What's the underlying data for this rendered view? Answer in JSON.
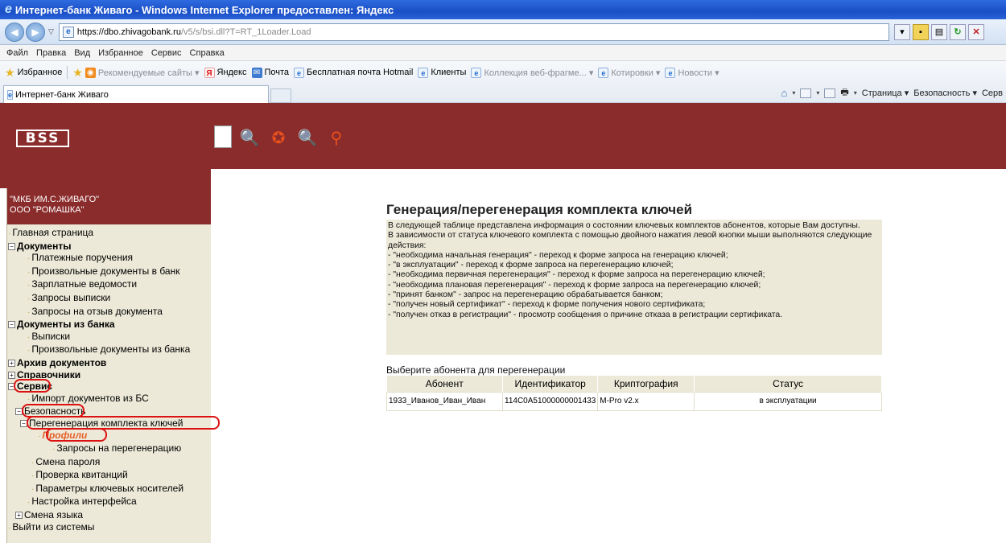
{
  "browser": {
    "title": "Интернет-банк Живаго - Windows Internet Explorer предоставлен: Яндекс",
    "url_host": "https://dbo.zhivagobank.ru",
    "url_path": "/v5/s/bsi.dll?T=RT_1Loader.Load",
    "menu": [
      "Файл",
      "Правка",
      "Вид",
      "Избранное",
      "Сервис",
      "Справка"
    ],
    "favorites_label": "Избранное",
    "favorites": [
      {
        "label": "Рекомендуемые сайты ▾",
        "icon": "rss-icon",
        "muted": true
      },
      {
        "label": "Яндекс",
        "icon": "yandex-icon",
        "muted": false
      },
      {
        "label": "Почта",
        "icon": "mail-icon",
        "muted": false
      },
      {
        "label": "Бесплатная почта Hotmail",
        "icon": "ie-page-icon",
        "muted": false
      },
      {
        "label": "Клиенты",
        "icon": "ie-page-icon",
        "muted": false
      },
      {
        "label": "Коллекция веб-фрагме... ▾",
        "icon": "ie-page-icon",
        "muted": true
      },
      {
        "label": "Котировки ▾",
        "icon": "ie-page-icon",
        "muted": true
      },
      {
        "label": "Новости ▾",
        "icon": "ie-page-icon",
        "muted": true
      }
    ],
    "tab_title": "Интернет-банк Живаго",
    "command_bar": {
      "page": "Страница",
      "security": "Безопасность",
      "service": "Серв"
    }
  },
  "app": {
    "logo": "BSS",
    "org_name": "\"МКБ ИМ.С.ЖИВАГО\"",
    "org_client": "ООО \"РОМАШКА\"",
    "nav": {
      "home": "Главная страница",
      "documents": "Документы",
      "payment_orders": "Платежные поручения",
      "arbitrary_docs": "Произвольные документы в банк",
      "salary": "Зарплатные ведомости",
      "statement_requests": "Запросы выписки",
      "recall_requests": "Запросы на отзыв документа",
      "docs_from_bank": "Документы из банка",
      "statements": "Выписки",
      "arbitrary_from_bank": "Произвольные документы из банка",
      "archive": "Архив документов",
      "directories": "Справочники",
      "service": "Сервис",
      "import_docs": "Импорт документов из БС",
      "security": "Безопасность",
      "key_regen": "Перегенерация комплекта ключей",
      "profiles": "Профили",
      "regen_requests": "Запросы на перегенерацию",
      "change_password": "Смена пароля",
      "check_receipts": "Проверка квитанций",
      "key_media_params": "Параметры ключевых носителей",
      "interface_settings": "Настройка интерфейса",
      "change_language": "Смена языка",
      "logout": "Выйти из системы"
    },
    "main": {
      "title": "Генерация/перегенерация комплекта ключей",
      "info_lines": [
        "В следующей таблице представлена информация о состоянии ключевых комплектов абонентов, которые Вам доступны.",
        "В зависимости от статуса ключевого комплекта с помощью двойного нажатия левой кнопки мыши выполняются следующие действия:",
        "- \"необходима начальная генерация\" - переход к форме запроса на генерацию ключей;",
        "- \"в эксплуатации\" - переход к форме запроса на перегенерацию ключей;",
        "- \"необходима первичная перегенерация\" - переход к форме запроса на перегенерацию ключей;",
        "- \"необходима плановая перегенерация\" - переход к форме запроса на перегенерацию ключей;",
        "- \"принят банком\" - запрос на перегенерацию обрабатывается банком;",
        "- \"получен новый сертификат\" - переход к форме получения нового сертификата;",
        "- \"получен отказ в регистрации\" - просмотр сообщения о причине отказа в регистрации сертификата."
      ],
      "select_label": "Выберите абонента для перегенерации",
      "columns": [
        "Абонент",
        "Идентификатор",
        "Криптография",
        "Статус"
      ],
      "rows": [
        {
          "subscriber": "1933_Иванов_Иван_Иван",
          "id": "114C0A51000000001433",
          "crypto": "M-Pro v2.x",
          "status": "в эксплуатации"
        }
      ]
    }
  }
}
